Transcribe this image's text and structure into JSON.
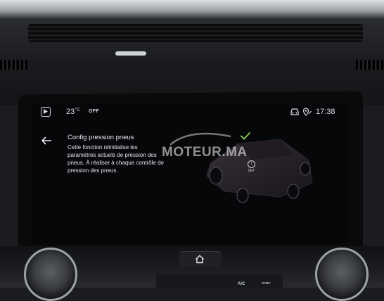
{
  "status_bar": {
    "temperature": "23",
    "temperature_unit": "°C",
    "ac_status": "OFF",
    "time": "17:38"
  },
  "content": {
    "title": "Config pression pneus",
    "description": "Cette fonction réinitialise les paramètres actuels de pression des pneus. À réaliser à chaque contrôle de pression des pneus.",
    "reset_label": "SET",
    "reset_symbol": "!"
  },
  "watermark": "MOTEUR.MA",
  "console": {
    "ac_label": "A/C",
    "sync_label": "SYNC"
  },
  "icons": {
    "media": "play-circle-icon",
    "car": "car-icon",
    "location": "location-pin-icon",
    "back": "back-arrow-icon",
    "home": "home-icon",
    "check": "checkmark-icon"
  },
  "colors": {
    "screen_bg": "#060709",
    "text": "#e3e5e8",
    "check_green": "#8fd14f"
  }
}
